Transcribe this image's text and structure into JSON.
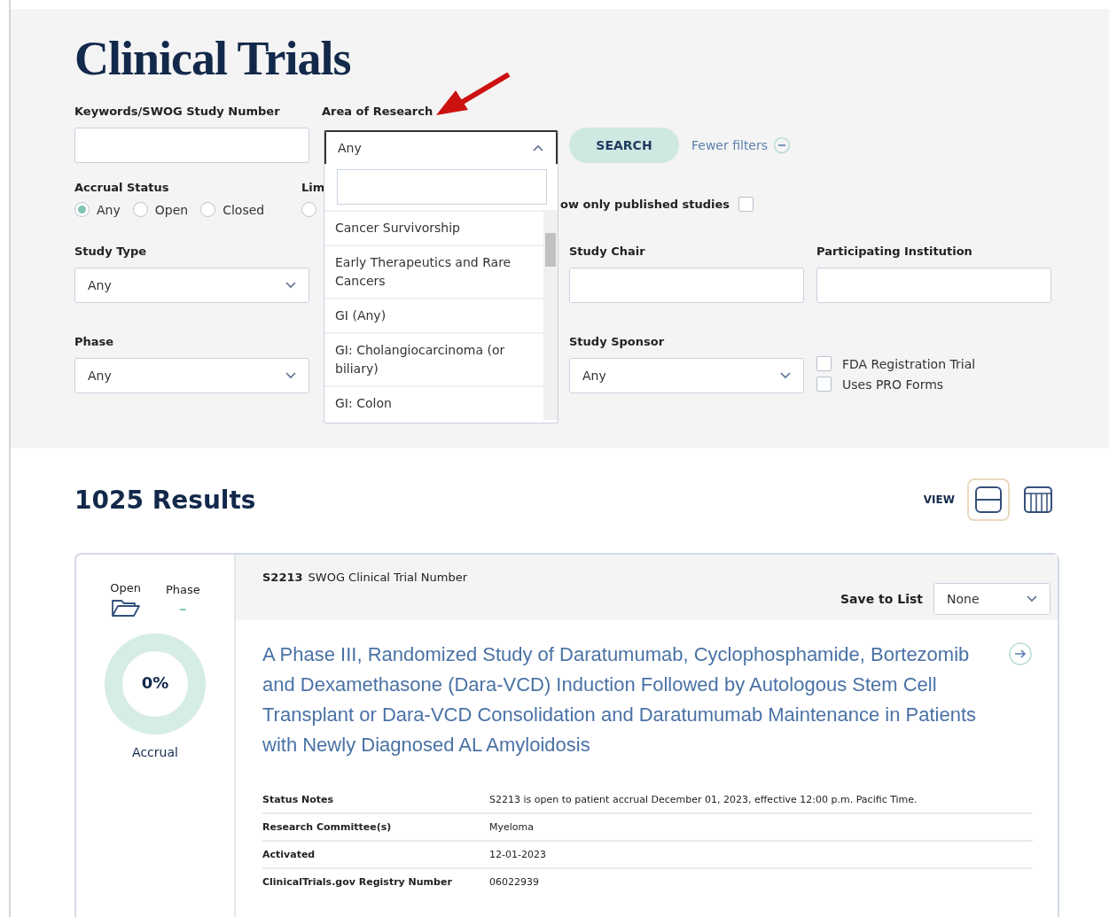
{
  "page_title": "Clinical Trials",
  "filters": {
    "keywords": {
      "label": "Keywords/SWOG Study Number"
    },
    "area_of_research": {
      "label": "Area of Research",
      "value": "Any",
      "expanded": true,
      "options": [
        {
          "label": "Cancer Survivorship"
        },
        {
          "label": "Early Therapeutics and Rare Cancers"
        },
        {
          "label": "GI (Any)"
        },
        {
          "label": "GI: Cholangiocarcinoma (or biliary)"
        },
        {
          "label": "GI: Colon"
        }
      ]
    },
    "search_button": "SEARCH",
    "fewer_filters": "Fewer filters",
    "accrual_status": {
      "label": "Accrual Status",
      "options": [
        {
          "label": "Any",
          "selected": true
        },
        {
          "label": "Open",
          "selected": false
        },
        {
          "label": "Closed",
          "selected": false
        }
      ]
    },
    "limit_label": "Lim",
    "limit_radio": {
      "selected": false
    },
    "published_only": {
      "label": "ow only published studies",
      "checked": false
    },
    "study_type": {
      "label": "Study Type",
      "value": "Any"
    },
    "study_chair": {
      "label": "Study Chair"
    },
    "participating_institution": {
      "label": "Participating Institution"
    },
    "phase": {
      "label": "Phase",
      "value": "Any"
    },
    "study_sponsor": {
      "label": "Study Sponsor",
      "value": "Any"
    },
    "flags": [
      {
        "label": "FDA Registration Trial",
        "checked": false
      },
      {
        "label": "Uses PRO Forms",
        "checked": false
      }
    ]
  },
  "results": {
    "count": "1025 Results",
    "view_label": "VIEW",
    "views": [
      {
        "kind": "card",
        "selected": true
      },
      {
        "kind": "table",
        "selected": false
      }
    ]
  },
  "trial": {
    "status_label": "Open",
    "phase_label": "Phase",
    "phase_value": "–",
    "accrual": {
      "reading": "0%",
      "label": "Accrual",
      "level": 0
    },
    "number": "S2213",
    "number_label": "SWOG Clinical Trial Number",
    "save_label": "Save to List",
    "save_value": "None",
    "title": "A Phase III, Randomized Study of Daratumumab, Cyclophosphamide, Bortezomib and Dexamethasone (Dara-VCD) Induction Followed by Autologous Stem Cell Transplant or Dara-VCD Consolidation and Daratumumab Maintenance in Patients with Newly Diagnosed AL Amyloidosis",
    "details": [
      {
        "label": "Status Notes",
        "value": "S2213 is open to patient accrual December 01, 2023, effective 12:00 p.m. Pacific Time."
      },
      {
        "label": "Research Committee(s)",
        "value": "Myeloma"
      },
      {
        "label": "Activated",
        "value": "12-01-2023"
      },
      {
        "label": "ClinicalTrials.gov Registry Number",
        "value": "06022939"
      }
    ]
  }
}
